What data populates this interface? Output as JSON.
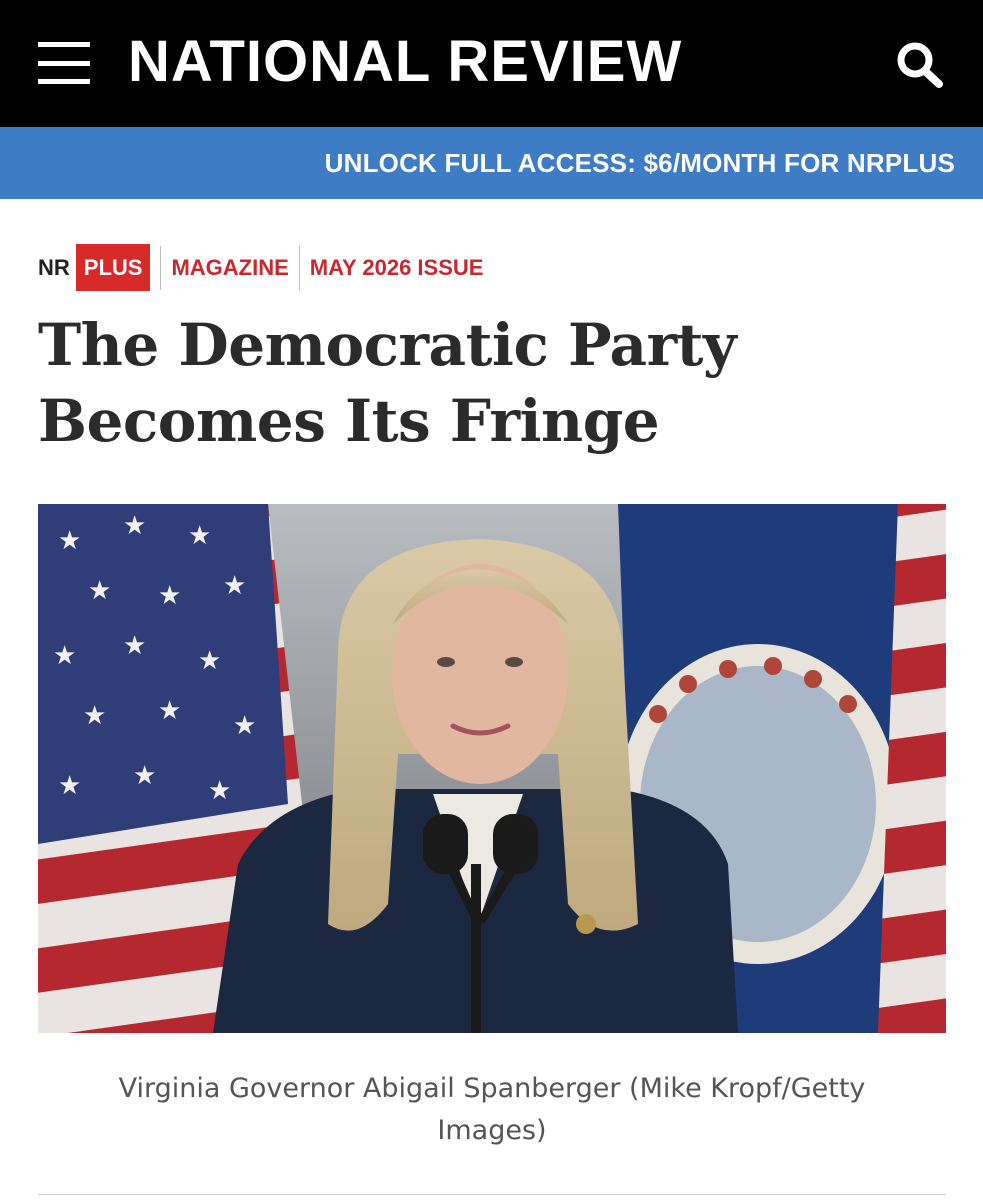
{
  "header": {
    "logo": "NATIONAL REVIEW",
    "menu_icon": "hamburger-menu-icon",
    "search_icon": "search-icon",
    "background": "#000000"
  },
  "promo": {
    "text": "UNLOCK FULL ACCESS: $6/MONTH FOR NRPLUS",
    "background": "#3f7cc6"
  },
  "article": {
    "badge_nr": "NR",
    "badge_plus": "PLUS",
    "section": "MAGAZINE",
    "issue": "MAY 2026 ISSUE",
    "title_line1": "The Democratic Party",
    "title_line2": "Becomes Its Fringe",
    "accent": "#c8282e"
  },
  "photo": {
    "caption_line1": "Virginia Governor Abigail Spanberger (Mike Kropf/Getty",
    "caption_line2": "Images)"
  }
}
